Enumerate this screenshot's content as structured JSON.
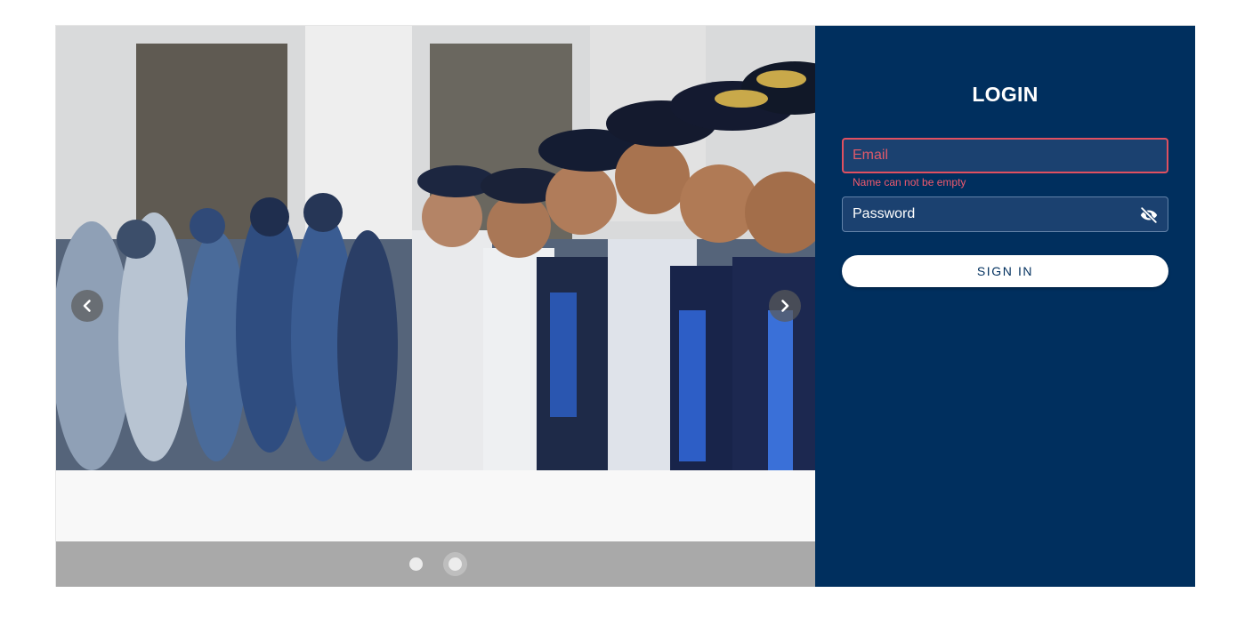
{
  "carousel": {
    "slide_image": "uniformed-officers-lineup-photo",
    "prev_icon": "chevron-left-icon",
    "next_icon": "chevron-right-icon",
    "slide_count": 2,
    "active_index": 1
  },
  "login": {
    "title": "LOGIN",
    "email_placeholder": "Email",
    "email_value": "",
    "email_error": "Name can not be empty",
    "password_placeholder": "Password",
    "password_value": "",
    "password_toggle_icon": "eye-off-icon",
    "signin_label": "SIGN IN"
  },
  "colors": {
    "panel_background": "#002f5e",
    "field_background": "#1b4170",
    "error": "#e05060",
    "button_background": "#ffffff",
    "indicator_bar": "#a9a9a9"
  }
}
